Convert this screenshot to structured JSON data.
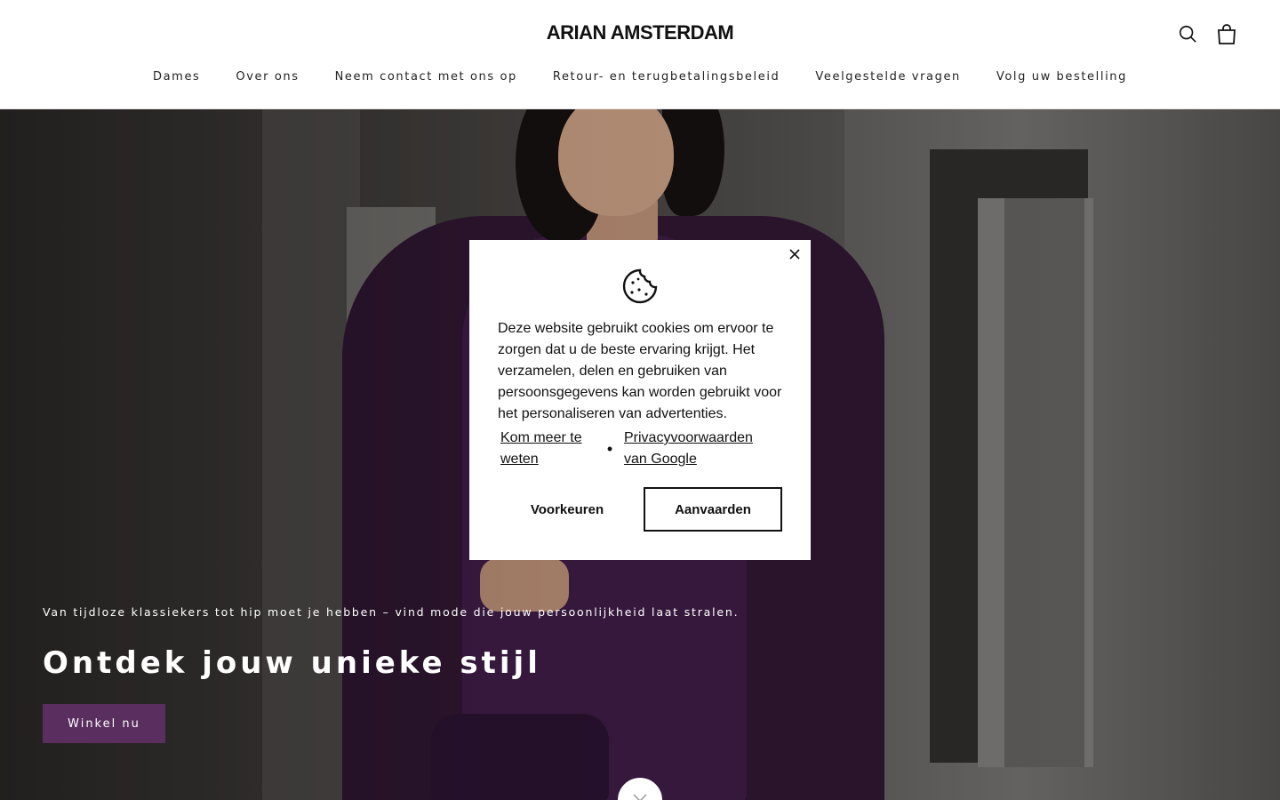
{
  "header": {
    "logo": "ARIAN AMSTERDAM",
    "icons": [
      "search-icon",
      "shopping-bag-icon"
    ]
  },
  "nav": {
    "items": [
      {
        "label": "Dames"
      },
      {
        "label": "Over ons"
      },
      {
        "label": "Neem contact met ons op"
      },
      {
        "label": "Retour- en terugbetalingsbeleid"
      },
      {
        "label": "Veelgestelde vragen"
      },
      {
        "label": "Volg uw bestelling"
      }
    ]
  },
  "hero": {
    "subtitle": "Van tijdloze klassiekers tot hip moet je hebben – vind mode die jouw persoonlijkheid laat stralen.",
    "title": "Ontdek jouw unieke stijl",
    "button_label": "Winkel nu",
    "button_color": "#5a2e5e"
  },
  "cookie_banner": {
    "icon": "cookie-icon",
    "message": "Deze website gebruikt cookies om ervoor te zorgen dat u de beste ervaring krijgt. Het verzamelen, delen en gebruiken van persoonsgegevens kan worden gebruikt voor het personaliseren van advertenties.",
    "link_learn_more": "Kom meer te weten",
    "link_privacy": "Privacyvoorwaarden van Google",
    "preferences_label": "Voorkeuren",
    "accept_label": "Aanvaarden"
  }
}
